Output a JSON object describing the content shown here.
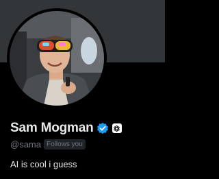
{
  "profile": {
    "display_name": "Sam Mogman",
    "handle": "@sama",
    "follows_you_label": "Follows you",
    "bio": "AI is cool i guess",
    "verified": true,
    "affiliate_badge_icon": "openai-logo-icon",
    "avatar_icon": "profile-photo"
  },
  "colors": {
    "banner": "#333639",
    "background": "#000000",
    "name_text": "#e7e9ea",
    "secondary_text": "#71767b",
    "verified_blue": "#1d9bf0",
    "follows_badge_bg": "#202327"
  }
}
